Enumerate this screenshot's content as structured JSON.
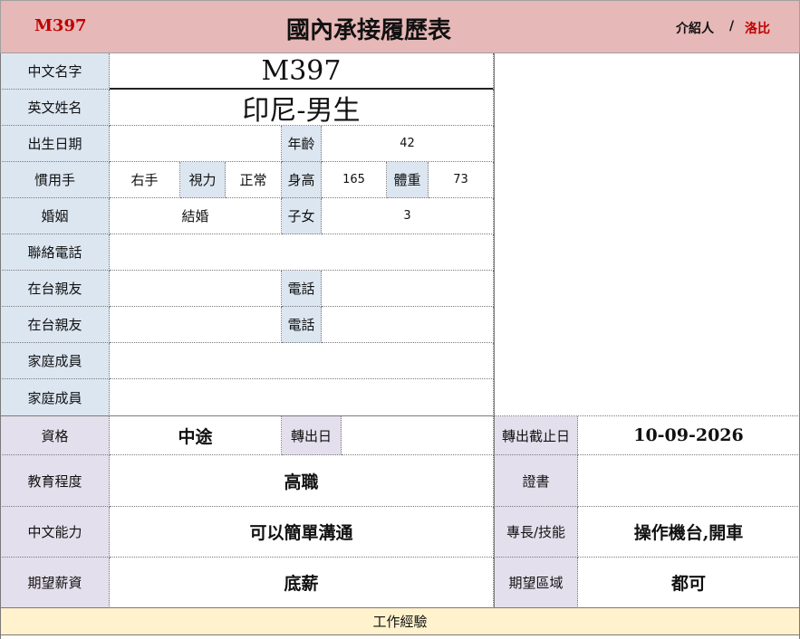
{
  "header": {
    "code": "M397",
    "title": "國內承接履歷表",
    "referrer_label": "介紹人",
    "separator": "/",
    "referrer_name": "洛比"
  },
  "profile": {
    "chinese_name_label": "中文名字",
    "chinese_name": "M397",
    "english_name_label": "英文姓名",
    "english_name": "印尼-男生",
    "birth_label": "出生日期",
    "birth_value": "",
    "age_label": "年齡",
    "age": "42",
    "hand_label": "慣用手",
    "hand": "右手",
    "vision_label": "視力",
    "vision": "正常",
    "height_label": "身高",
    "height": "165",
    "weight_label": "體重",
    "weight": "73",
    "marriage_label": "婚姻",
    "marriage": "結婚",
    "children_label": "子女",
    "children": "3",
    "phone_label": "聯絡電話",
    "relative1_label": "在台親友",
    "relative1_phone_label": "電話",
    "relative2_label": "在台親友",
    "relative2_phone_label": "電話",
    "family1_label": "家庭成員",
    "family2_label": "家庭成員"
  },
  "details": {
    "qualification_label": "資格",
    "qualification": "中途",
    "transfer_date_label": "轉出日",
    "transfer_date": "",
    "deadline_label": "轉出截止日",
    "deadline": "10-09-2026",
    "education_label": "教育程度",
    "education": "高職",
    "certificate_label": "證書",
    "certificate": "",
    "chinese_ability_label": "中文能力",
    "chinese_ability": "可以簡單溝通",
    "skills_label": "專長/技能",
    "skills": "操作機台,開車",
    "salary_label": "期望薪資",
    "salary": "底薪",
    "region_label": "期望區域",
    "region": "都可"
  },
  "work_experience_label": "工作經驗",
  "colors": {
    "header_bg": "#e6b8b7",
    "label_blue": "#dce6f1",
    "label_purple": "#e4dfec",
    "section_yellow": "#fff2cc",
    "accent_red": "#c00000"
  }
}
